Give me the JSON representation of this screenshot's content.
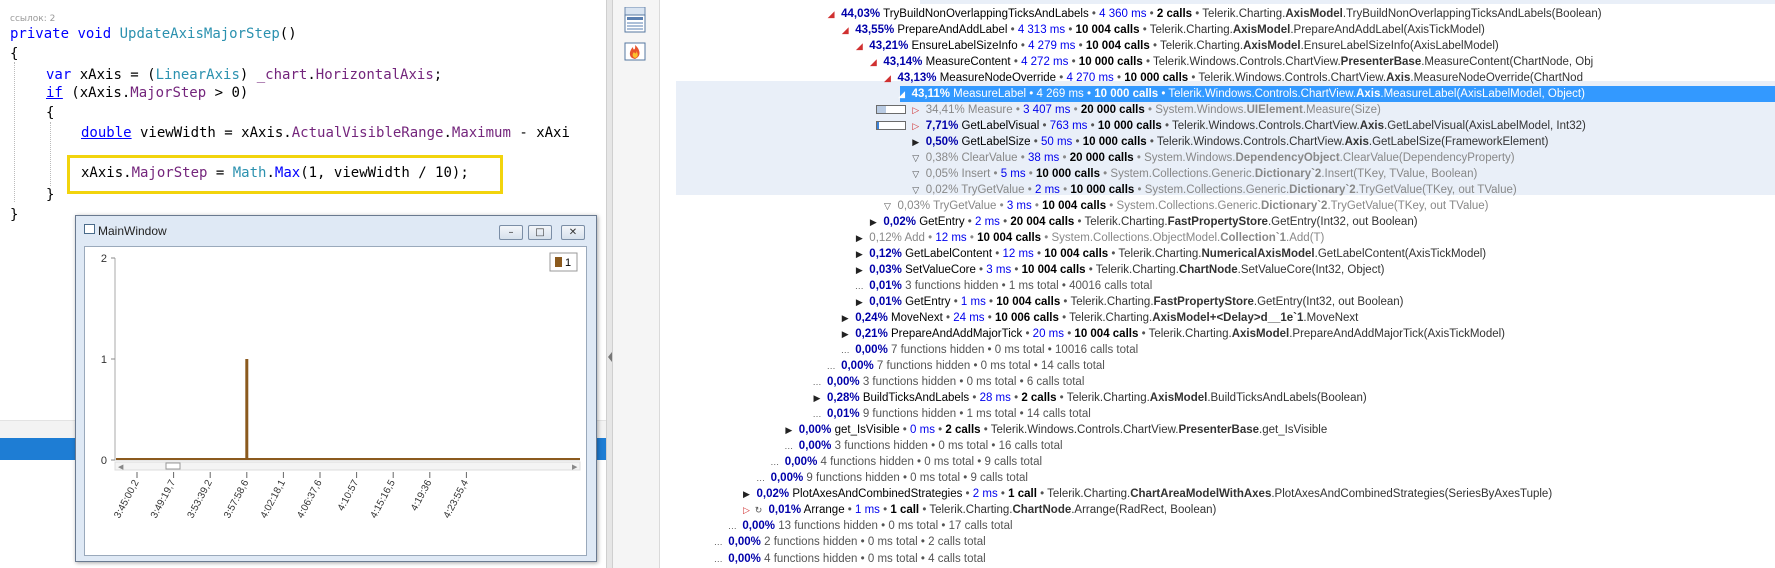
{
  "editor": {
    "codelens": "ссылок: 2",
    "signature": {
      "kw1": "private",
      "kw2": "void",
      "name": "UpdateAxisMajorStep",
      "rest": "()"
    },
    "brace_open": "{",
    "line_var": {
      "kw": "var",
      "a": " xAxis = (",
      "type": "LinearAxis",
      "b": ") ",
      "field": "_chart",
      "c": ".",
      "prop": "HorizontalAxis",
      "d": ";"
    },
    "line_if": {
      "kw": "if",
      "a": " (xAxis.",
      "prop": "MajorStep",
      "b": " > 0)"
    },
    "brace_open2": "{",
    "line_double": {
      "kw": "double",
      "a": " viewWidth = xAxis.",
      "p1": "ActualVisibleRange",
      "b": ".",
      "p2": "Maximum",
      "c": " - xAxi"
    },
    "line_assign": {
      "a": "xAxis.",
      "p1": "MajorStep",
      "b": " = ",
      "p2": "Math",
      "c": ".",
      "p3": "Max",
      "d": "(1, viewWidth / 10);"
    },
    "brace_close2": "}",
    "brace_close": "}"
  },
  "main_window": {
    "title": "MainWindow",
    "buttons": {
      "minimize": "–",
      "maximize": "□",
      "close": "✕"
    },
    "legend_label": "1"
  },
  "chart_data": {
    "type": "bar",
    "categories": [
      "3:45:00,2",
      "3:49:19,7",
      "3:53:39,2",
      "3:57:58,6",
      "4:02:18,1",
      "4:06:37,6",
      "4:10:57",
      "4:15:16,5",
      "4:19:36",
      "4:23:55,4"
    ],
    "series": [
      {
        "name": "1",
        "values": [
          0,
          0,
          0,
          1,
          0,
          0,
          0,
          0,
          0,
          0
        ]
      }
    ],
    "spike_category_offset": 0.0,
    "yticks": [
      "2",
      "1",
      "0"
    ],
    "ylim": [
      0,
      2
    ],
    "legend": "top-right",
    "colors": {
      "series": "#8b5a1e"
    }
  },
  "profiler": {
    "rows": [
      {
        "depth": 11,
        "kind": "open",
        "pct": "44,03%",
        "name": "TryBuildNonOverlappingTicksAndLabels",
        "ms": "4 360 ms",
        "calls": "2 calls",
        "ns": "Telerik.Charting.",
        "cls": "AxisModel",
        "method": ".TryBuildNonOverlappingTicksAndLabels(Boolean)"
      },
      {
        "depth": 12,
        "kind": "open",
        "pct": "43,55%",
        "name": "PrepareAndAddLabel",
        "ms": "4 313 ms",
        "calls": "10 004 calls",
        "ns": "Telerik.Charting.",
        "cls": "AxisModel",
        "method": ".PrepareAndAddLabel(AxisTickModel)"
      },
      {
        "depth": 13,
        "kind": "open",
        "pct": "43,21%",
        "name": "EnsureLabelSizeInfo",
        "ms": "4 279 ms",
        "calls": "10 004 calls",
        "ns": "Telerik.Charting.",
        "cls": "AxisModel",
        "method": ".EnsureLabelSizeInfo(AxisLabelModel)"
      },
      {
        "depth": 14,
        "kind": "open",
        "pct": "43,14%",
        "name": "MeasureContent",
        "ms": "4 272 ms",
        "calls": "10 000 calls",
        "ns": "Telerik.Windows.Controls.ChartView.",
        "cls": "PresenterBase",
        "method": ".MeasureContent(ChartNode, Obj"
      },
      {
        "depth": 15,
        "kind": "open",
        "pct": "43,13%",
        "name": "MeasureNodeOverride",
        "ms": "4 270 ms",
        "calls": "10 000 calls",
        "ns": "Telerik.Windows.Controls.ChartView.",
        "cls": "Axis",
        "method": ".MeasureNodeOverride(ChartNod"
      },
      {
        "depth": 16,
        "kind": "open",
        "sel": true,
        "pct": "43,11%",
        "name": "MeasureLabel",
        "ms": "4 269 ms",
        "calls": "10 000 calls",
        "ns": "Telerik.Windows.Controls.ChartView.",
        "cls": "Axis",
        "method": ".MeasureLabel(AxisLabelModel, Object)"
      },
      {
        "depth": 17,
        "kind": "closed-red",
        "bar": 0.35,
        "dim": true,
        "pct": "34,41%",
        "name": "Measure",
        "ms": "3 407 ms",
        "calls": "20 000 calls",
        "ns": "System.Windows.",
        "cls": "UIElement",
        "method": ".Measure(Size)"
      },
      {
        "depth": 17,
        "kind": "closed-red",
        "bar": 0.08,
        "pct": "7,71%",
        "name": "GetLabelVisual",
        "ms": "763 ms",
        "calls": "10 000 calls",
        "ns": "Telerik.Windows.Controls.ChartView.",
        "cls": "Axis",
        "method": ".GetLabelVisual(AxisLabelModel, Int32)"
      },
      {
        "depth": 17,
        "kind": "closed",
        "pct": "0,50%",
        "name": "GetLabelSize",
        "ms": "50 ms",
        "calls": "10 000 calls",
        "ns": "Telerik.Windows.Controls.ChartView.",
        "cls": "Axis",
        "method": ".GetLabelSize(FrameworkElement)"
      },
      {
        "depth": 17,
        "kind": "filter",
        "dim": true,
        "pct": "0,38%",
        "name": "ClearValue",
        "ms": "38 ms",
        "calls": "20 000 calls",
        "ns": "System.Windows.",
        "cls": "DependencyObject",
        "method": ".ClearValue(DependencyProperty)"
      },
      {
        "depth": 17,
        "kind": "filter",
        "dim": true,
        "pct": "0,05%",
        "name": "Insert",
        "ms": "5 ms",
        "calls": "10 000 calls",
        "ns": "System.Collections.Generic.",
        "cls": "Dictionary`2",
        "method": ".Insert(TKey, TValue, Boolean)"
      },
      {
        "depth": 17,
        "kind": "filter",
        "dim": true,
        "pct": "0,02%",
        "name": "TryGetValue",
        "ms": "2 ms",
        "calls": "10 000 calls",
        "ns": "System.Collections.Generic.",
        "cls": "Dictionary`2",
        "method": ".TryGetValue(TKey, out TValue)"
      },
      {
        "depth": 15,
        "kind": "filter",
        "dim": true,
        "pct": "0,03%",
        "name": "TryGetValue",
        "ms": "3 ms",
        "calls": "10 004 calls",
        "ns": "System.Collections.Generic.",
        "cls": "Dictionary`2",
        "method": ".TryGetValue(TKey, out TValue)"
      },
      {
        "depth": 14,
        "kind": "closed",
        "pct": "0,02%",
        "name": "GetEntry",
        "ms": "2 ms",
        "calls": "20 004 calls",
        "ns": "Telerik.Charting.",
        "cls": "FastPropertyStore",
        "method": ".GetEntry(Int32, out Boolean)"
      },
      {
        "depth": 13,
        "kind": "closed",
        "dim": true,
        "pct": "0,12%",
        "name": "Add",
        "ms": "12 ms",
        "calls": "10 004 calls",
        "ns": "System.Collections.ObjectModel.",
        "cls": "Collection`1",
        "method": ".Add(T)"
      },
      {
        "depth": 13,
        "kind": "closed",
        "pct": "0,12%",
        "name": "GetLabelContent",
        "ms": "12 ms",
        "calls": "10 004 calls",
        "ns": "Telerik.Charting.",
        "cls": "NumericalAxisModel",
        "method": ".GetLabelContent(AxisTickModel)"
      },
      {
        "depth": 13,
        "kind": "closed",
        "pct": "0,03%",
        "name": "SetValueCore",
        "ms": "3 ms",
        "calls": "10 004 calls",
        "ns": "Telerik.Charting.",
        "cls": "ChartNode",
        "method": ".SetValueCore(Int32, Object)"
      },
      {
        "depth": 13,
        "kind": "hidden",
        "pct": "0,01%",
        "text": "3 functions hidden • 1 ms total • 40016 calls total"
      },
      {
        "depth": 13,
        "kind": "closed",
        "pct": "0,01%",
        "name": "GetEntry",
        "ms": "1 ms",
        "calls": "10 004 calls",
        "ns": "Telerik.Charting.",
        "cls": "FastPropertyStore",
        "method": ".GetEntry(Int32, out Boolean)"
      },
      {
        "depth": 12,
        "kind": "closed",
        "pct": "0,24%",
        "name": "MoveNext",
        "ms": "24 ms",
        "calls": "10 006 calls",
        "ns": "Telerik.Charting.",
        "cls": "AxisModel+<Delay>d__1e`1",
        "method": ".MoveNext"
      },
      {
        "depth": 12,
        "kind": "closed",
        "pct": "0,21%",
        "name": "PrepareAndAddMajorTick",
        "ms": "20 ms",
        "calls": "10 004 calls",
        "ns": "Telerik.Charting.",
        "cls": "AxisModel",
        "method": ".PrepareAndAddMajorTick(AxisTickModel)"
      },
      {
        "depth": 12,
        "kind": "hidden",
        "pct": "0,00%",
        "text": "7 functions hidden • 0 ms total • 10016 calls total"
      },
      {
        "depth": 11,
        "kind": "hidden",
        "pct": "0,00%",
        "text": "7 functions hidden • 0 ms total • 14 calls total"
      },
      {
        "depth": 10,
        "kind": "hidden",
        "pct": "0,00%",
        "text": "3 functions hidden • 0 ms total • 6 calls total"
      },
      {
        "depth": 10,
        "kind": "closed",
        "pct": "0,28%",
        "name": "BuildTicksAndLabels",
        "ms": "28 ms",
        "calls": "2 calls",
        "ns": "Telerik.Charting.",
        "cls": "AxisModel",
        "method": ".BuildTicksAndLabels(Boolean)"
      },
      {
        "depth": 10,
        "kind": "hidden",
        "pct": "0,01%",
        "text": "9 functions hidden • 1 ms total • 14 calls total"
      },
      {
        "depth": 8,
        "kind": "closed",
        "pct": "0,00%",
        "name": "get_IsVisible",
        "ms": "0 ms",
        "calls": "2 calls",
        "ns": "Telerik.Windows.Controls.ChartView.",
        "cls": "PresenterBase",
        "method": ".get_IsVisible"
      },
      {
        "depth": 8,
        "kind": "hidden",
        "pct": "0,00%",
        "text": "3 functions hidden • 0 ms total • 16 calls total"
      },
      {
        "depth": 7,
        "kind": "hidden",
        "pct": "0,00%",
        "text": "4 functions hidden • 0 ms total • 9 calls total"
      },
      {
        "depth": 6,
        "kind": "hidden",
        "pct": "0,00%",
        "text": "9 functions hidden • 0 ms total • 9 calls total"
      },
      {
        "depth": 5,
        "kind": "closed",
        "pct": "0,02%",
        "name": "PlotAxesAndCombinedStrategies",
        "ms": "2 ms",
        "calls": "1 call",
        "ns": "Telerik.Charting.",
        "cls": "ChartAreaModelWithAxes",
        "method": ".PlotAxesAndCombinedStrategies(SeriesByAxesTuple)"
      },
      {
        "depth": 5,
        "kind": "closed-loop",
        "pct": "0,01%",
        "name": "Arrange",
        "ms": "1 ms",
        "calls": "1 call",
        "ns": "Telerik.Charting.",
        "cls": "ChartNode",
        "method": ".Arrange(RadRect, Boolean)"
      },
      {
        "depth": 4,
        "kind": "hidden",
        "pct": "0,00%",
        "text": "13 functions hidden • 0 ms total • 17 calls total"
      },
      {
        "depth": 3,
        "kind": "hidden",
        "pct": "0,00%",
        "text": "2 functions hidden • 0 ms total • 2 calls total"
      },
      {
        "depth": 3,
        "kind": "hidden",
        "pct": "0,00%",
        "text": "4 functions hidden • 0 ms total • 4 calls total"
      }
    ]
  }
}
